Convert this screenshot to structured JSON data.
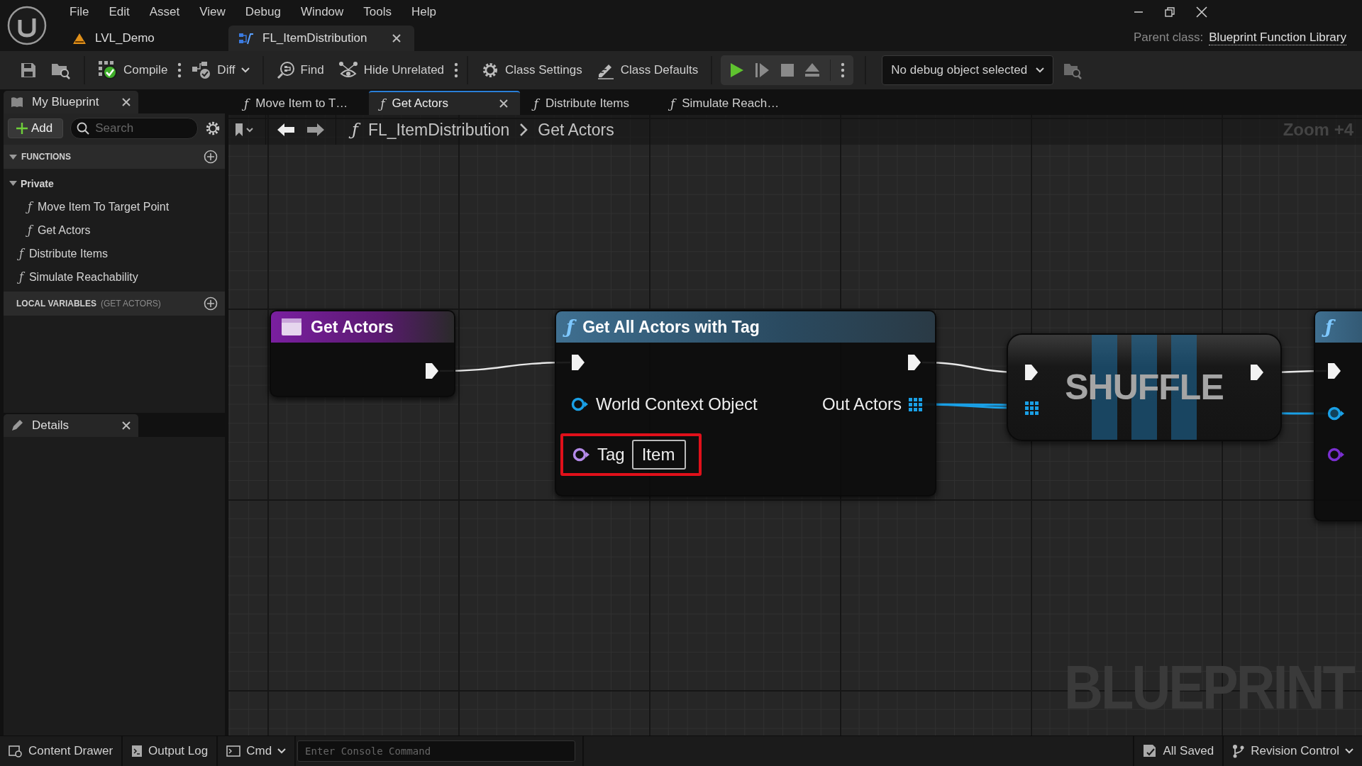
{
  "window": {
    "menu": [
      "File",
      "Edit",
      "Asset",
      "View",
      "Debug",
      "Window",
      "Tools",
      "Help"
    ],
    "document_tabs": [
      {
        "label": "LVL_Demo",
        "kind": "level",
        "selected": false
      },
      {
        "label": "FL_ItemDistribution",
        "kind": "blueprint",
        "selected": true
      }
    ],
    "parent_class_label": "Parent class:",
    "parent_class": "Blueprint Function Library"
  },
  "toolbar": {
    "items": [
      {
        "kind": "save"
      },
      {
        "kind": "browse"
      },
      {
        "kind": "compile",
        "label": "Compile",
        "menu": true
      },
      {
        "kind": "diff",
        "label": "Diff",
        "dropdown": true
      },
      {
        "kind": "find",
        "label": "Find"
      },
      {
        "kind": "hide",
        "label": "Hide Unrelated",
        "menu": true
      },
      {
        "kind": "settings",
        "label": "Class Settings"
      },
      {
        "kind": "defaults",
        "label": "Class Defaults"
      }
    ],
    "play": [
      {
        "kind": "play"
      },
      {
        "kind": "step"
      },
      {
        "kind": "stop"
      },
      {
        "kind": "eject"
      }
    ],
    "debug_object": "No debug object selected"
  },
  "my_blueprint": {
    "title": "My Blueprint",
    "add": "Add",
    "search_placeholder": "Search",
    "functions": {
      "title": "FUNCTIONS",
      "expanded": true,
      "items": [
        {
          "label": "Private",
          "kind": "category",
          "expanded": true,
          "children": [
            {
              "label": "Move Item To Target Point",
              "kind": "function",
              "icon": "ƒ"
            },
            {
              "label": "Get Actors",
              "kind": "function",
              "icon": "ƒ"
            }
          ]
        },
        {
          "label": "Distribute Items",
          "kind": "function",
          "icon": "ƒ"
        },
        {
          "label": "Simulate Reachability",
          "kind": "function",
          "icon": "ƒ"
        }
      ]
    },
    "local_variables": {
      "title": "LOCAL VARIABLES",
      "scope": "(GET ACTORS)"
    }
  },
  "details": {
    "title": "Details"
  },
  "graph": {
    "tabs": [
      {
        "label": "Move Item to T…",
        "icon": "ƒ",
        "selected": false
      },
      {
        "label": "Get Actors",
        "icon": "ƒ",
        "selected": true
      },
      {
        "label": "Distribute Items",
        "icon": "ƒ",
        "selected": false
      },
      {
        "label": "Simulate Reach…",
        "icon": "ƒ",
        "selected": false
      }
    ],
    "breadcrumb_icon": "ƒ",
    "breadcrumb": [
      "FL_ItemDistribution",
      "Get Actors"
    ],
    "zoom": "Zoom +4",
    "watermark": "BLUEPRINT",
    "nodes": [
      {
        "kind": "entry",
        "title": "Get Actors"
      },
      {
        "kind": "function",
        "icon": "ƒ",
        "title": "Get All Actors with Tag",
        "inputs": [
          {
            "label": "World Context Object",
            "color": "#1aa0e6"
          },
          {
            "label": "Tag",
            "color": "#b48ae8",
            "value": "Item",
            "highlighted": true
          }
        ],
        "outputs": [
          {
            "label": "Out Actors",
            "color": "#1aa0e6",
            "kind": "array"
          }
        ]
      },
      {
        "kind": "macro",
        "title": "SHUFFLE"
      },
      {
        "kind": "partial",
        "icon": "ƒ",
        "pins": [
          {
            "color": "#1aa0e6"
          },
          {
            "color": "#7a2fd0"
          }
        ]
      }
    ]
  },
  "status_bar": {
    "items": [
      {
        "kind": "content",
        "label": "Content Drawer"
      },
      {
        "kind": "log",
        "label": "Output Log"
      },
      {
        "kind": "cmd",
        "label": "Cmd"
      }
    ],
    "console_placeholder": "Enter Console Command",
    "right": [
      {
        "kind": "saved",
        "label": "All Saved"
      },
      {
        "kind": "revision",
        "label": "Revision Control"
      }
    ]
  }
}
